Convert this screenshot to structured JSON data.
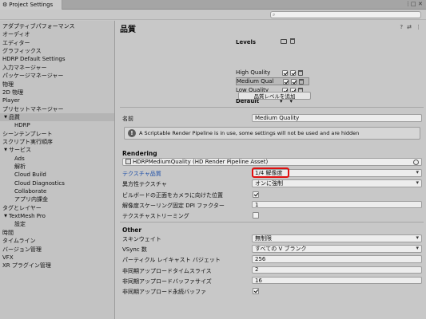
{
  "window": {
    "tab_title": "Project Settings",
    "menu_glyph": "⋮",
    "maximize_glyph": "□",
    "close_glyph": "✕"
  },
  "search": {
    "placeholder": "",
    "icon": "search-icon"
  },
  "sidebar": {
    "items": [
      {
        "label": "アダプティブパフォーマンス",
        "indent": 0,
        "arrow": ""
      },
      {
        "label": "オーディオ",
        "indent": 0,
        "arrow": ""
      },
      {
        "label": "エディター",
        "indent": 0,
        "arrow": ""
      },
      {
        "label": "グラフィックス",
        "indent": 0,
        "arrow": ""
      },
      {
        "label": "HDRP Default Settings",
        "indent": 0,
        "arrow": ""
      },
      {
        "label": "入力マネージャー",
        "indent": 0,
        "arrow": ""
      },
      {
        "label": "パッケージマネージャー",
        "indent": 0,
        "arrow": ""
      },
      {
        "label": "物理",
        "indent": 0,
        "arrow": ""
      },
      {
        "label": "2D 物理",
        "indent": 0,
        "arrow": ""
      },
      {
        "label": "Player",
        "indent": 0,
        "arrow": ""
      },
      {
        "label": "プリセットマネージャー",
        "indent": 0,
        "arrow": ""
      },
      {
        "label": "品質",
        "indent": 0,
        "arrow": "▼",
        "selected": true
      },
      {
        "label": "HDRP",
        "indent": 2,
        "arrow": ""
      },
      {
        "label": "シーンテンプレート",
        "indent": 0,
        "arrow": ""
      },
      {
        "label": "スクリプト実行順序",
        "indent": 0,
        "arrow": ""
      },
      {
        "label": "サービス",
        "indent": 0,
        "arrow": "▼"
      },
      {
        "label": "Ads",
        "indent": 2,
        "arrow": ""
      },
      {
        "label": "解析",
        "indent": 2,
        "arrow": ""
      },
      {
        "label": "Cloud Build",
        "indent": 2,
        "arrow": ""
      },
      {
        "label": "Cloud Diagnostics",
        "indent": 2,
        "arrow": ""
      },
      {
        "label": "Collaborate",
        "indent": 2,
        "arrow": ""
      },
      {
        "label": "アプリ内課金",
        "indent": 2,
        "arrow": ""
      },
      {
        "label": "タグとレイヤー",
        "indent": 0,
        "arrow": ""
      },
      {
        "label": "TextMesh Pro",
        "indent": 0,
        "arrow": "▼"
      },
      {
        "label": "設定",
        "indent": 2,
        "arrow": ""
      },
      {
        "label": "時間",
        "indent": 0,
        "arrow": ""
      },
      {
        "label": "タイムライン",
        "indent": 0,
        "arrow": ""
      },
      {
        "label": "バージョン管理",
        "indent": 0,
        "arrow": ""
      },
      {
        "label": "VFX",
        "indent": 0,
        "arrow": ""
      },
      {
        "label": "XR プラグイン管理",
        "indent": 0,
        "arrow": ""
      }
    ]
  },
  "main": {
    "title": "品質",
    "header_icons": [
      "?",
      "⇄",
      "⋮"
    ],
    "levels": {
      "heading": "Levels",
      "rows": [
        {
          "name": "High Quality",
          "checked": true,
          "selected": false
        },
        {
          "name": "Medium Qual",
          "checked": true,
          "selected": true
        },
        {
          "name": "Low Quality",
          "checked": true,
          "selected": false
        }
      ],
      "default_label": "Default",
      "default_arrow": "▾",
      "add_button": "品質レベルを追加"
    },
    "name_label": "名前",
    "name_value": "Medium Quality",
    "info_text": "A Scriptable Render Pipeline is in use, some settings will not be used and are hidden",
    "rendering": {
      "heading": "Rendering",
      "asset_value": "HDRPMediumQuality (HD Render Pipeline Asset)",
      "rows": [
        {
          "label": "テクスチャ品質",
          "value": "1/4 解像度",
          "kind": "dropdown",
          "highlight": true
        },
        {
          "label": "異方性テクスチャ",
          "value": "オンに強制",
          "kind": "dropdown"
        },
        {
          "label": "ビルボードの正面をカメラに向けた位置",
          "value": "",
          "kind": "checkbox",
          "checked": true
        },
        {
          "label": "解像度スケーリング固定 DPI ファクター",
          "value": "1",
          "kind": "number"
        },
        {
          "label": "テクスチャストリーミング",
          "value": "",
          "kind": "checkbox",
          "checked": false
        }
      ]
    },
    "other": {
      "heading": "Other",
      "rows": [
        {
          "label": "スキンウェイト",
          "value": "無制限",
          "kind": "dropdown"
        },
        {
          "label": "VSync 数",
          "value": "すべての V ブランク",
          "kind": "dropdown"
        },
        {
          "label": "パーティクル レイキャスト バジェット",
          "value": "256",
          "kind": "number"
        },
        {
          "label": "非同期アップロードタイムスライス",
          "value": "2",
          "kind": "number"
        },
        {
          "label": "非同期アップロードバッファサイズ",
          "value": "16",
          "kind": "number"
        },
        {
          "label": "非同期アップロード永続バッファ",
          "value": "",
          "kind": "checkbox",
          "checked": true
        }
      ]
    }
  }
}
